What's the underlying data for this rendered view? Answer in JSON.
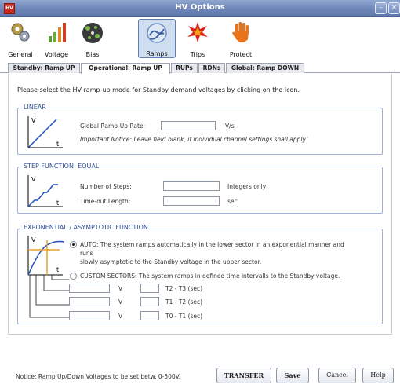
{
  "window": {
    "title": "HV Options",
    "app_logo": "HV"
  },
  "toolbar": {
    "items": [
      {
        "label": "General",
        "icon": "gears-icon"
      },
      {
        "label": "Voltage",
        "icon": "bars-icon"
      },
      {
        "label": "Bias",
        "icon": "bias-icon"
      },
      {
        "label": "Ramps",
        "icon": "ramps-icon",
        "active": true
      },
      {
        "label": "Trips",
        "icon": "burst-icon"
      },
      {
        "label": "Protect",
        "icon": "hand-icon"
      }
    ]
  },
  "tabs": [
    {
      "label": "Standby: Ramp UP"
    },
    {
      "label": "Operational: Ramp UP",
      "selected": true
    },
    {
      "label": "RUPs"
    },
    {
      "label": "RDNs"
    },
    {
      "label": "Global: Ramp DOWN"
    }
  ],
  "intro": "Please select the HV ramp-up mode for Standby demand voltages by clicking on the icon.",
  "linear": {
    "legend": "LINEAR",
    "rate_label": "Global Ramp-Up Rate:",
    "rate_value": "",
    "rate_unit": "V/s",
    "notice": "Important Notice: Leave field blank, if individual channel settings shall apply!"
  },
  "step": {
    "legend": "STEP FUNCTION: EQUAL",
    "steps_label": "Number of Steps:",
    "steps_value": "",
    "steps_hint": "Integers only!",
    "timeout_label": "Time-out Length:",
    "timeout_value": "",
    "timeout_unit": "sec"
  },
  "exponential": {
    "legend": "EXPONENTIAL / ASYMPTOTIC FUNCTION",
    "auto_line1": "AUTO: The system ramps automatically in the lower sector in an exponential manner and",
    "auto_line2": "runs",
    "auto_line3": "slowly asymptotic to the Standby voltage in the upper sector.",
    "auto_selected": true,
    "custom_text": "CUSTOM SECTORS: The system ramps in defined time intervalls to the Standby voltage.",
    "sectors": [
      {
        "unit": "V",
        "label": "T2 - T3 (sec)"
      },
      {
        "unit": "V",
        "label": "T1 - T2 (sec)"
      },
      {
        "unit": "V",
        "label": "T0 - T1 (sec)"
      }
    ]
  },
  "graph_labels": {
    "v": "V",
    "t": "t"
  },
  "footer": {
    "notice": "Notice: Ramp Up/Down Voltages to be set betw. 0-500V.",
    "transfer": "TRANSFER",
    "save": "Save",
    "cancel": "Cancel",
    "help": "Help"
  },
  "colors": {
    "accent": "#2f4f93",
    "titlebar": "#6d86b8",
    "graph_line": "#1f4fbf"
  }
}
